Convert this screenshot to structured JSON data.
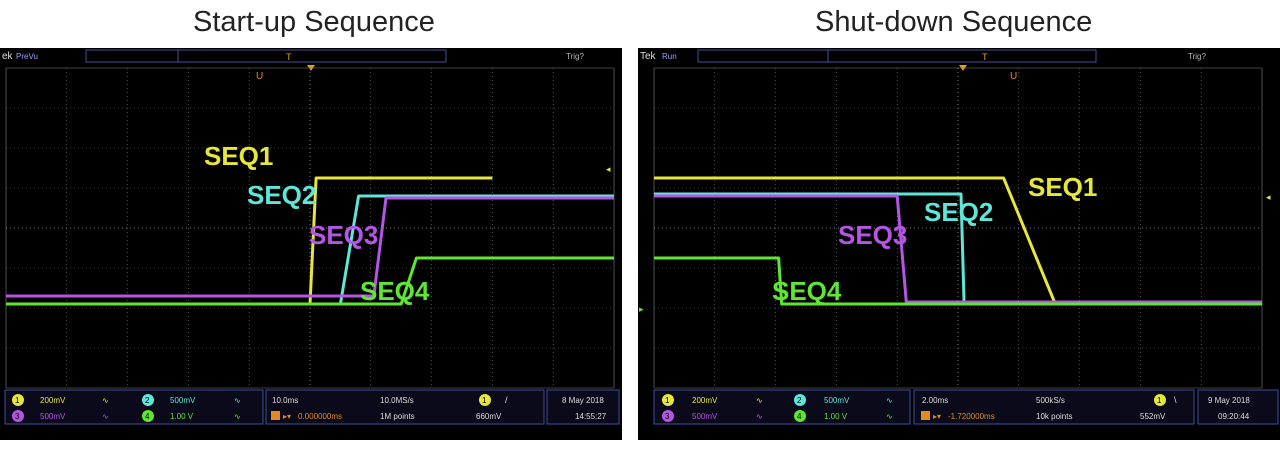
{
  "titles": {
    "left": "Start-up Sequence",
    "right": "Shut-down Sequence"
  },
  "colors": {
    "ch1": "#e6e63c",
    "ch2": "#5ee6d8",
    "ch3": "#b455e6",
    "ch4": "#5fe632",
    "grid": "#7f7f7f",
    "bg": "#000000"
  },
  "scopes": [
    {
      "brand": "ek",
      "mode": "PreVu",
      "trig_status": "Trig?",
      "labels": {
        "seq1": "SEQ1",
        "seq2": "SEQ2",
        "seq3": "SEQ3",
        "seq4": "SEQ4"
      },
      "readout": {
        "ch1": "200mV",
        "ch2": "500mV",
        "ch3": "500mV",
        "ch4": "1.00 V",
        "timebase": "10.0ms",
        "sample_rate": "10.0MS/s",
        "delay": "0.000000ms",
        "record": "1M points",
        "trig_ch": "1",
        "trig_slope": "/",
        "trig_level": "660mV",
        "date": "8 May 2018",
        "time": "14:55:27"
      }
    },
    {
      "brand": "Tek",
      "mode": "Run",
      "trig_status": "Trig?",
      "labels": {
        "seq1": "SEQ1",
        "seq2": "SEQ2",
        "seq3": "SEQ3",
        "seq4": "SEQ4"
      },
      "readout": {
        "ch1": "200mV",
        "ch2": "500mV",
        "ch3": "500mV",
        "ch4": "1.00 V",
        "timebase": "2.00ms",
        "sample_rate": "500kS/s",
        "delay": "-1.720000ms",
        "record": "10k points",
        "trig_ch": "1",
        "trig_slope": "\\",
        "trig_level": "552mV",
        "date": "9 May 2018",
        "time": "09:20:44"
      }
    }
  ],
  "chart_data": [
    {
      "type": "line",
      "title": "Start-up Sequence",
      "x_divisions": 10,
      "y_divisions": 8,
      "x_unit": "ms",
      "x_per_div": 10,
      "series": [
        {
          "name": "SEQ1",
          "channel": 1,
          "color": "#e6e63c",
          "x": [
            -50,
            0,
            1,
            30
          ],
          "y_div": [
            -1.9,
            -1.9,
            1.25,
            1.25
          ]
        },
        {
          "name": "SEQ2",
          "channel": 2,
          "color": "#5ee6d8",
          "x": [
            -50,
            5,
            8,
            50
          ],
          "y_div": [
            -1.9,
            -1.9,
            0.8,
            0.8
          ]
        },
        {
          "name": "SEQ3",
          "channel": 3,
          "color": "#b455e6",
          "x": [
            -50,
            10.5,
            12.5,
            50
          ],
          "y_div": [
            -1.7,
            -1.7,
            0.75,
            0.75
          ]
        },
        {
          "name": "SEQ4",
          "channel": 4,
          "color": "#5fe632",
          "x": [
            -50,
            15,
            17.5,
            50
          ],
          "y_div": [
            -1.9,
            -1.9,
            -0.75,
            -0.75
          ]
        }
      ]
    },
    {
      "type": "line",
      "title": "Shut-down Sequence",
      "x_divisions": 10,
      "y_divisions": 8,
      "x_unit": "ms",
      "x_per_div": 2,
      "series": [
        {
          "name": "SEQ1",
          "channel": 1,
          "color": "#e6e63c",
          "x": [
            -10,
            1.5,
            3.2,
            10
          ],
          "y_div": [
            1.25,
            1.25,
            -1.9,
            -1.9
          ]
        },
        {
          "name": "SEQ2",
          "channel": 2,
          "color": "#5ee6d8",
          "x": [
            -10,
            0.1,
            0.2,
            10
          ],
          "y_div": [
            0.85,
            0.85,
            -1.9,
            -1.9
          ]
        },
        {
          "name": "SEQ3",
          "channel": 3,
          "color": "#b455e6",
          "x": [
            -10,
            -2,
            -1.7,
            10
          ],
          "y_div": [
            0.8,
            0.8,
            -1.85,
            -1.85
          ]
        },
        {
          "name": "SEQ4",
          "channel": 4,
          "color": "#5fe632",
          "x": [
            -10,
            -5.9,
            -5.8,
            10
          ],
          "y_div": [
            -0.75,
            -0.75,
            -1.9,
            -1.9
          ]
        }
      ]
    }
  ]
}
